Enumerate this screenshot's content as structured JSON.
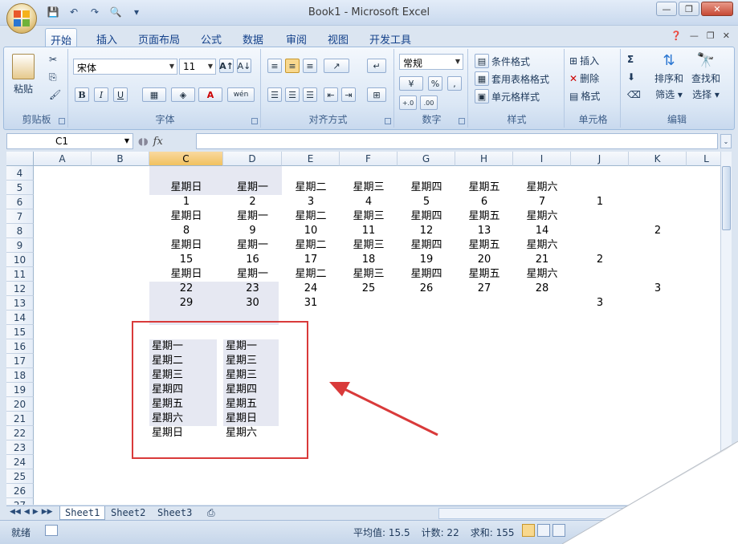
{
  "window": {
    "title": "Book1 - Microsoft Excel",
    "controls": [
      "—",
      "❐",
      "✕"
    ]
  },
  "ribbon": {
    "tabs": [
      "开始",
      "插入",
      "页面布局",
      "公式",
      "数据",
      "审阅",
      "视图",
      "开发工具"
    ],
    "active_tab": "开始",
    "groups": {
      "clipboard": {
        "label": "剪贴板",
        "paste": "粘贴"
      },
      "font": {
        "label": "字体",
        "font_name": "宋体",
        "font_size": "11",
        "bold": "B",
        "italic": "I",
        "underline": "U",
        "font_color": "A",
        "phonetic": "wén"
      },
      "alignment": {
        "label": "对齐方式"
      },
      "number": {
        "label": "数字",
        "format": "常规",
        "percent": "%",
        "comma": ",",
        "inc_dec": "+.0",
        "dec_dec": ".00"
      },
      "styles": {
        "label": "样式",
        "conditional": "条件格式",
        "table_format": "套用表格格式",
        "cell_styles": "单元格样式"
      },
      "cells": {
        "label": "单元格",
        "insert": "插入",
        "delete": "删除",
        "format": "格式"
      },
      "editing": {
        "label": "编辑",
        "sum": "Σ",
        "sort_filter": "排序和\n筛选",
        "find_select": "查找和\n选择"
      }
    }
  },
  "formula_bar": {
    "name_box": "C1",
    "fx": "fx",
    "formula": ""
  },
  "grid": {
    "columns": [
      "A",
      "B",
      "C",
      "D",
      "E",
      "F",
      "G",
      "H",
      "I",
      "J",
      "K",
      "L"
    ],
    "selected_columns": [
      "C"
    ],
    "rows": [
      "4",
      "5",
      "6",
      "7",
      "8",
      "9",
      "10",
      "11",
      "12",
      "13",
      "14",
      "15",
      "16",
      "17",
      "18",
      "19",
      "20",
      "21",
      "22",
      "23",
      "24",
      "25",
      "26",
      "27"
    ],
    "calendar": [
      {
        "row": "5",
        "cells": [
          "星期日",
          "星期一",
          "星期二",
          "星期三",
          "星期四",
          "星期五",
          "星期六"
        ]
      },
      {
        "row": "6",
        "cells": [
          "1",
          "2",
          "3",
          "4",
          "5",
          "6",
          "7"
        ],
        "J": "1"
      },
      {
        "row": "7",
        "cells": [
          "星期日",
          "星期一",
          "星期二",
          "星期三",
          "星期四",
          "星期五",
          "星期六"
        ]
      },
      {
        "row": "8",
        "cells": [
          "8",
          "9",
          "10",
          "11",
          "12",
          "13",
          "14"
        ],
        "K": "2"
      },
      {
        "row": "9",
        "cells": [
          "星期日",
          "星期一",
          "星期二",
          "星期三",
          "星期四",
          "星期五",
          "星期六"
        ]
      },
      {
        "row": "10",
        "cells": [
          "15",
          "16",
          "17",
          "18",
          "19",
          "20",
          "21"
        ],
        "J": "2"
      },
      {
        "row": "11",
        "cells": [
          "星期日",
          "星期一",
          "星期二",
          "星期三",
          "星期四",
          "星期五",
          "星期六"
        ]
      },
      {
        "row": "12",
        "cells": [
          "22",
          "23",
          "24",
          "25",
          "26",
          "27",
          "28"
        ],
        "K": "3"
      },
      {
        "row": "13",
        "cells": [
          "29",
          "30",
          "31"
        ],
        "J": "3"
      }
    ],
    "list_c": [
      "星期一",
      "星期二",
      "星期三",
      "星期四",
      "星期五",
      "星期六",
      "星期日"
    ],
    "list_d": [
      "星期一",
      "星期三",
      "星期三",
      "星期四",
      "星期五",
      "星期日",
      "星期六"
    ]
  },
  "sheets": [
    "Sheet1",
    "Sheet2",
    "Sheet3"
  ],
  "active_sheet": "Sheet1",
  "status": {
    "ready": "就绪",
    "average": "平均值: 15.5",
    "count": "计数: 22",
    "sum": "求和: 155"
  },
  "colors": {
    "selection_header": "#f1c15f",
    "shade": "#e6e8f2",
    "annotation": "#d93a3a"
  }
}
